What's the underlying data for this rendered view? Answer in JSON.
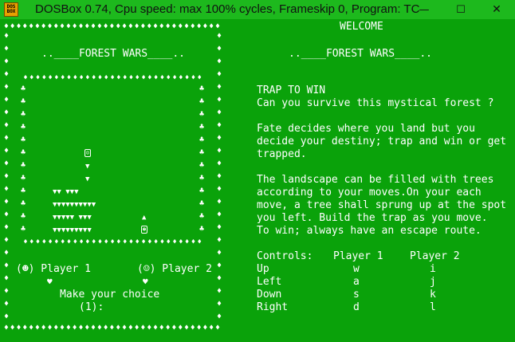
{
  "window": {
    "title": "DOSBox 0.74, Cpu speed: max 100% cycles, Frameskip  0, Program:      TC",
    "icon_top": "DOS",
    "icon_bottom": "BOX",
    "minimize_glyph": "—",
    "maximize_glyph": "☐",
    "close_glyph": "✕"
  },
  "left": {
    "game_title": "..____FOREST WARS____..",
    "player1_label": "(☻) Player 1",
    "player2_label": "(☺) Player 2",
    "heart": "♥",
    "prompt": "Make your choice",
    "choice": "(1):"
  },
  "right": {
    "welcome": "WELCOME",
    "game_title": "..____FOREST WARS____..",
    "section_heading": "TRAP TO WIN",
    "intro": "Can you survive this mystical forest ?",
    "para1": [
      "Fate decides where you land but you",
      "decide your destiny; trap and win or get",
      "trapped."
    ],
    "para2": [
      "The landscape can be filled with trees",
      "according to your moves.On your each",
      "move, a tree shall sprung up at the spot",
      "you left. Build the trap as you move.",
      "To win; always have an escape route."
    ],
    "controls": {
      "header": [
        "Controls:",
        "Player 1",
        "Player 2"
      ],
      "rows": [
        [
          "Up",
          "w",
          "i"
        ],
        [
          "Left",
          "a",
          "j"
        ],
        [
          "Down",
          "s",
          "k"
        ],
        [
          "Right",
          "d",
          "l"
        ]
      ]
    }
  },
  "board": {
    "border_glyph": "♦",
    "club_glyph": "♣",
    "tree_glyph": "▼",
    "up_glyph": "▲",
    "tree_rows": [
      "▼▼ ▼▼▼",
      "▼▼▼▼▼▼▼▼▼▼",
      "▼▼▼▼▼  ▼▼▼",
      "▼▼▼▼▼▼▼▼▼"
    ],
    "colors": {
      "background": "#0aa20a",
      "foreground": "#ffffff"
    }
  }
}
